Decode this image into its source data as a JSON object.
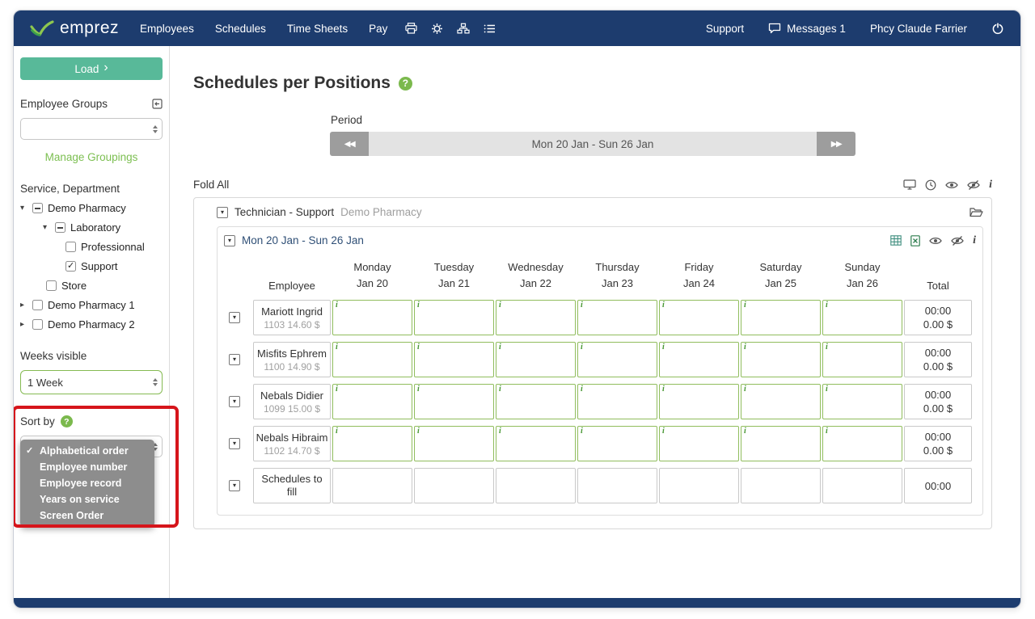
{
  "navbar": {
    "brand": "emprez",
    "items": [
      "Employees",
      "Schedules",
      "Time Sheets",
      "Pay"
    ],
    "support": "Support",
    "messages": "Messages 1",
    "user": "Phcy Claude Farrier"
  },
  "sidebar": {
    "load": "Load",
    "employee_groups": "Employee Groups",
    "group_select_value": "",
    "manage_groupings": "Manage Groupings",
    "service_department": "Service, Department",
    "tree": [
      {
        "label": "Demo Pharmacy"
      },
      {
        "label": "Laboratory"
      },
      {
        "label": "Professionnal"
      },
      {
        "label": "Support"
      },
      {
        "label": "Store"
      },
      {
        "label": "Demo Pharmacy 1"
      },
      {
        "label": "Demo Pharmacy 2"
      }
    ],
    "weeks_visible": "Weeks visible",
    "weeks_value": "1 Week",
    "sort_by": "Sort by",
    "sort_options": [
      "Alphabetical order",
      "Employee number",
      "Employee record",
      "Years on service",
      "Screen Order"
    ],
    "sort_selected": "Alphabetical order"
  },
  "main": {
    "title": "Schedules per Positions",
    "period_label": "Period",
    "period_value": "Mon 20 Jan - Sun 26 Jan",
    "fold_all": "Fold All",
    "panel": {
      "title": "Technician - Support",
      "subtitle": "Demo Pharmacy",
      "week_title": "Mon 20 Jan - Sun 26 Jan",
      "employee_header": "Employee",
      "total_header": "Total",
      "columns": [
        {
          "day": "Monday",
          "date": "Jan 20"
        },
        {
          "day": "Tuesday",
          "date": "Jan 21"
        },
        {
          "day": "Wednesday",
          "date": "Jan 22"
        },
        {
          "day": "Thursday",
          "date": "Jan 23"
        },
        {
          "day": "Friday",
          "date": "Jan 24"
        },
        {
          "day": "Saturday",
          "date": "Jan 25"
        },
        {
          "day": "Sunday",
          "date": "Jan 26"
        }
      ],
      "rows": [
        {
          "name": "Mariott Ingrid",
          "meta": "1103 14.60 $",
          "total_time": "00:00",
          "total_money": "0.00 $"
        },
        {
          "name": "Misfits Ephrem",
          "meta": "1100 14.90 $",
          "total_time": "00:00",
          "total_money": "0.00 $"
        },
        {
          "name": "Nebals Didier",
          "meta": "1099 15.00 $",
          "total_time": "00:00",
          "total_money": "0.00 $"
        },
        {
          "name": "Nebals Hibraim",
          "meta": "1102 14.70 $",
          "total_time": "00:00",
          "total_money": "0.00 $"
        }
      ],
      "fill_row": {
        "name": "Schedules to fill",
        "total_time": "00:00"
      }
    }
  },
  "icons": {
    "load_chevron": "›",
    "period_prev": "◀◀",
    "period_next": "▶▶",
    "check": "✓",
    "help": "?",
    "info": "i",
    "caret_down": "▾",
    "caret_right": "▸"
  },
  "colors": {
    "navy": "#1d3c6e",
    "teal_button": "#58b999",
    "green_link": "#7cbf51",
    "cell_border_green": "#90bd5d",
    "annotation_red": "#d6151b",
    "dropdown_gray": "#8d8d8d"
  }
}
